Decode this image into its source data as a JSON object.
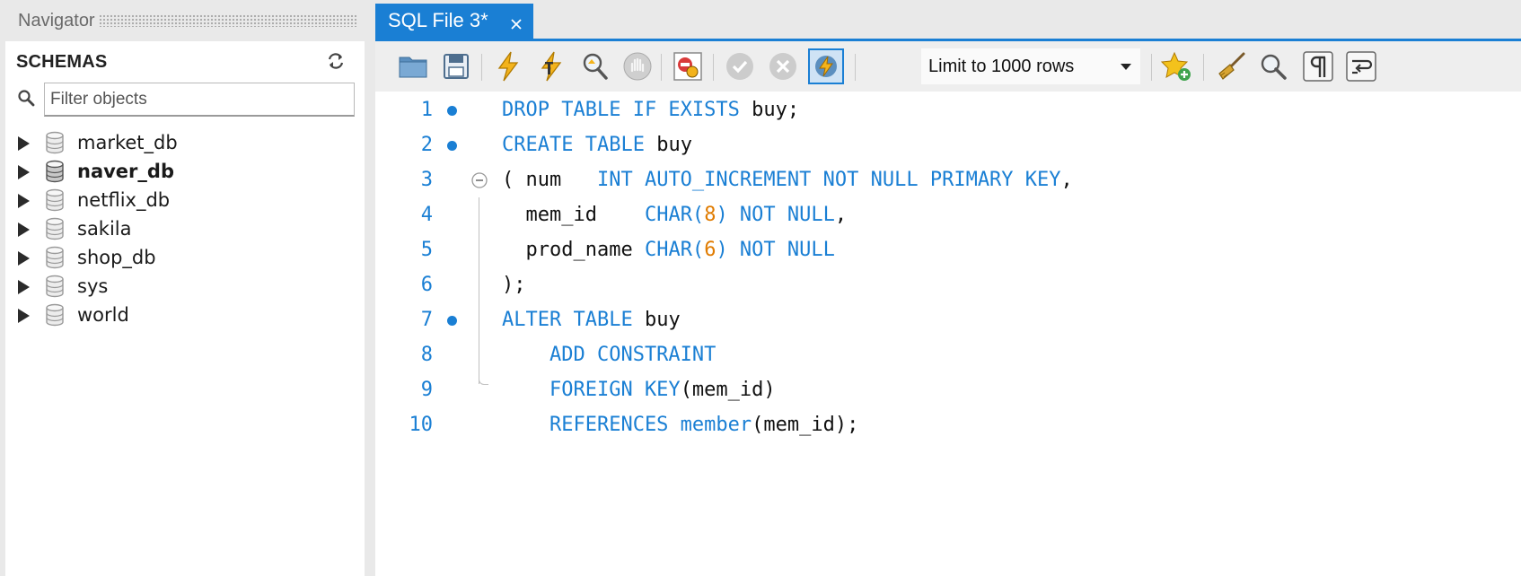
{
  "navigator": {
    "title": "Navigator",
    "schemas_label": "SCHEMAS",
    "filter_placeholder": "Filter objects",
    "schemas": [
      {
        "name": "market_db",
        "bold": false
      },
      {
        "name": "naver_db",
        "bold": true
      },
      {
        "name": "netflix_db",
        "bold": false
      },
      {
        "name": "sakila",
        "bold": false
      },
      {
        "name": "shop_db",
        "bold": false
      },
      {
        "name": "sys",
        "bold": false
      },
      {
        "name": "world",
        "bold": false
      }
    ]
  },
  "editor": {
    "tab_label": "SQL File 3*",
    "limit_label": "Limit to 1000 rows",
    "toolbar_icons": [
      "open-file-icon",
      "save-icon",
      "execute-icon",
      "execute-current-icon",
      "explain-icon",
      "stop-icon",
      "toggle-continue-on-error-icon",
      "commit-icon",
      "rollback-icon",
      "autocommit-icon",
      "add-snippet-icon",
      "beautify-icon",
      "find-icon",
      "show-invisible-icon",
      "word-wrap-icon"
    ],
    "lines": [
      {
        "no": "1",
        "dot": true,
        "tokens": [
          {
            "t": "DROP TABLE IF EXISTS",
            "c": "kw"
          },
          {
            "t": " buy;",
            "c": "plain"
          }
        ]
      },
      {
        "no": "2",
        "dot": true,
        "tokens": [
          {
            "t": "CREATE TABLE",
            "c": "kw"
          },
          {
            "t": " buy",
            "c": "plain"
          }
        ]
      },
      {
        "no": "3",
        "dot": false,
        "fold": true,
        "tokens": [
          {
            "t": "( num   ",
            "c": "plain"
          },
          {
            "t": "INT AUTO_INCREMENT NOT NULL PRIMARY KEY",
            "c": "kw"
          },
          {
            "t": ",",
            "c": "plain"
          }
        ]
      },
      {
        "no": "4",
        "dot": false,
        "tokens": [
          {
            "t": "  mem_id    ",
            "c": "plain"
          },
          {
            "t": "CHAR(",
            "c": "kw"
          },
          {
            "t": "8",
            "c": "num"
          },
          {
            "t": ") NOT NULL",
            "c": "kw"
          },
          {
            "t": ",",
            "c": "plain"
          }
        ]
      },
      {
        "no": "5",
        "dot": false,
        "tokens": [
          {
            "t": "  prod_name ",
            "c": "plain"
          },
          {
            "t": "CHAR(",
            "c": "kw"
          },
          {
            "t": "6",
            "c": "num"
          },
          {
            "t": ") NOT NULL",
            "c": "kw"
          }
        ]
      },
      {
        "no": "6",
        "dot": false,
        "tokens": [
          {
            "t": ");",
            "c": "plain"
          }
        ]
      },
      {
        "no": "7",
        "dot": true,
        "tokens": [
          {
            "t": "ALTER TABLE",
            "c": "kw"
          },
          {
            "t": " buy",
            "c": "plain"
          }
        ]
      },
      {
        "no": "8",
        "dot": false,
        "tokens": [
          {
            "t": "    ADD CONSTRAINT",
            "c": "kw"
          }
        ]
      },
      {
        "no": "9",
        "dot": false,
        "tokens": [
          {
            "t": "    FOREIGN KEY",
            "c": "kw"
          },
          {
            "t": "(mem_id)",
            "c": "plain"
          }
        ]
      },
      {
        "no": "10",
        "dot": false,
        "tokens": [
          {
            "t": "    REFERENCES member",
            "c": "kw"
          },
          {
            "t": "(mem_id);",
            "c": "plain"
          }
        ]
      }
    ]
  },
  "colors": {
    "accent": "#1a7fd4",
    "keyword": "#1a7fd4",
    "number": "#e07b00"
  }
}
